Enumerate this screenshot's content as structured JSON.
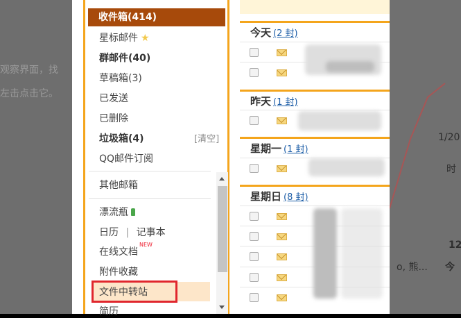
{
  "background_left": {
    "line1": "观察界面，找",
    "line2": "左击点击它。"
  },
  "background_right": {
    "t1": "1/20",
    "t2": "时",
    "t3": "12",
    "t4": "o, 熊...",
    "t5": "今"
  },
  "sidebar": {
    "inbox": "收件箱(414)",
    "starred": "星标邮件",
    "group_mail": "群邮件(40)",
    "drafts": "草稿箱(3)",
    "sent": "已发送",
    "deleted": "已删除",
    "spam": "垃圾箱(4)",
    "spam_clear": "[清空]",
    "qq_subscription": "QQ邮件订阅",
    "other_mailboxes": "其他邮箱",
    "drift_bottle": "漂流瓶",
    "calendar": "日历",
    "separator": "|",
    "notebook": "记事本",
    "online_docs": "在线文档",
    "new_badge": "NEW",
    "attachments": "附件收藏",
    "file_transfer": "文件中转站",
    "resume": "简历"
  },
  "mail_list": {
    "groups": [
      {
        "label": "今天",
        "count": "(2 封)"
      },
      {
        "label": "昨天",
        "count": "(1 封)"
      },
      {
        "label": "星期一",
        "count": "(1 封)"
      },
      {
        "label": "星期日",
        "count": "(8 封)"
      }
    ]
  },
  "colors": {
    "accent_orange": "#f4a51c",
    "inbox_selected": "#a74a0b",
    "highlight_box": "#e0262d",
    "link_blue": "#1f5fa8"
  }
}
